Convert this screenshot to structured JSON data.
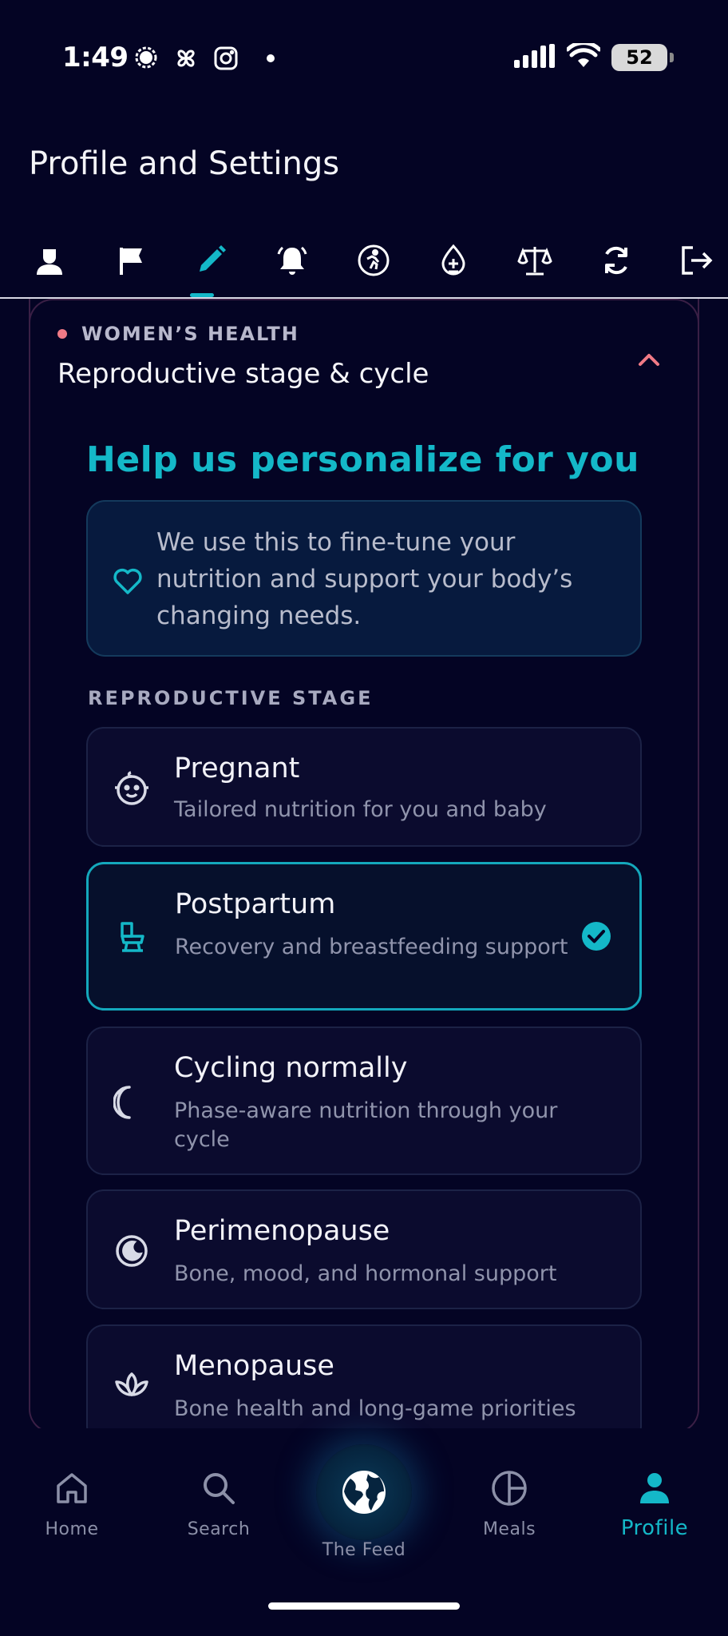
{
  "status_bar": {
    "time": "1:49",
    "battery": "52",
    "icons_left": [
      "chat-bubble-icon",
      "pinwheel-icon",
      "instagram-icon"
    ],
    "icons_right": [
      "signal-icon",
      "wifi-icon",
      "battery-icon"
    ]
  },
  "header": {
    "title": "Profile and Settings"
  },
  "tabs": [
    {
      "icon": "person-icon",
      "active": false
    },
    {
      "icon": "flag-icon",
      "active": false
    },
    {
      "icon": "pencil-icon",
      "active": true
    },
    {
      "icon": "bell-icon",
      "active": false
    },
    {
      "icon": "running-icon",
      "active": false
    },
    {
      "icon": "drop-plus-icon",
      "active": false
    },
    {
      "icon": "scale-icon",
      "active": false
    },
    {
      "icon": "sync-icon",
      "active": false
    },
    {
      "icon": "logout-icon",
      "active": false
    }
  ],
  "section": {
    "eyebrow": "WOMEN’S HEALTH",
    "title": "Reproductive stage & cycle",
    "heading": "Help us personalize for you",
    "info": "We use this to fine-tune your nutrition and support your body’s changing needs.",
    "stage_label": "REPRODUCTIVE STAGE",
    "options": [
      {
        "title": "Pregnant",
        "subtitle": "Tailored nutrition for you and baby",
        "icon": "baby-face-icon",
        "selected": false
      },
      {
        "title": "Postpartum",
        "subtitle": "Recovery and breastfeeding support",
        "icon": "stroller-icon",
        "selected": true
      },
      {
        "title": "Cycling normally",
        "subtitle": "Phase-aware nutrition through your cycle",
        "icon": "moon-icon",
        "selected": false
      },
      {
        "title": "Perimenopause",
        "subtitle": "Bone, mood, and hormonal support",
        "icon": "half-moon-circle-icon",
        "selected": false
      },
      {
        "title": "Menopause",
        "subtitle": "Bone health and long-game priorities",
        "icon": "lotus-icon",
        "selected": false
      }
    ]
  },
  "bottom_nav": {
    "items": [
      {
        "label": "Home",
        "icon": "home-icon"
      },
      {
        "label": "Search",
        "icon": "search-icon"
      },
      {
        "label": "The Feed",
        "icon": "globe-icon"
      },
      {
        "label": "Meals",
        "icon": "pie-icon"
      },
      {
        "label": "Profile",
        "icon": "profile-icon",
        "active": true
      }
    ]
  },
  "colors": {
    "background": "#040424",
    "accent": "#14b8c8",
    "eyebrow_dot": "#f07a86",
    "chevron": "#f07a86"
  }
}
